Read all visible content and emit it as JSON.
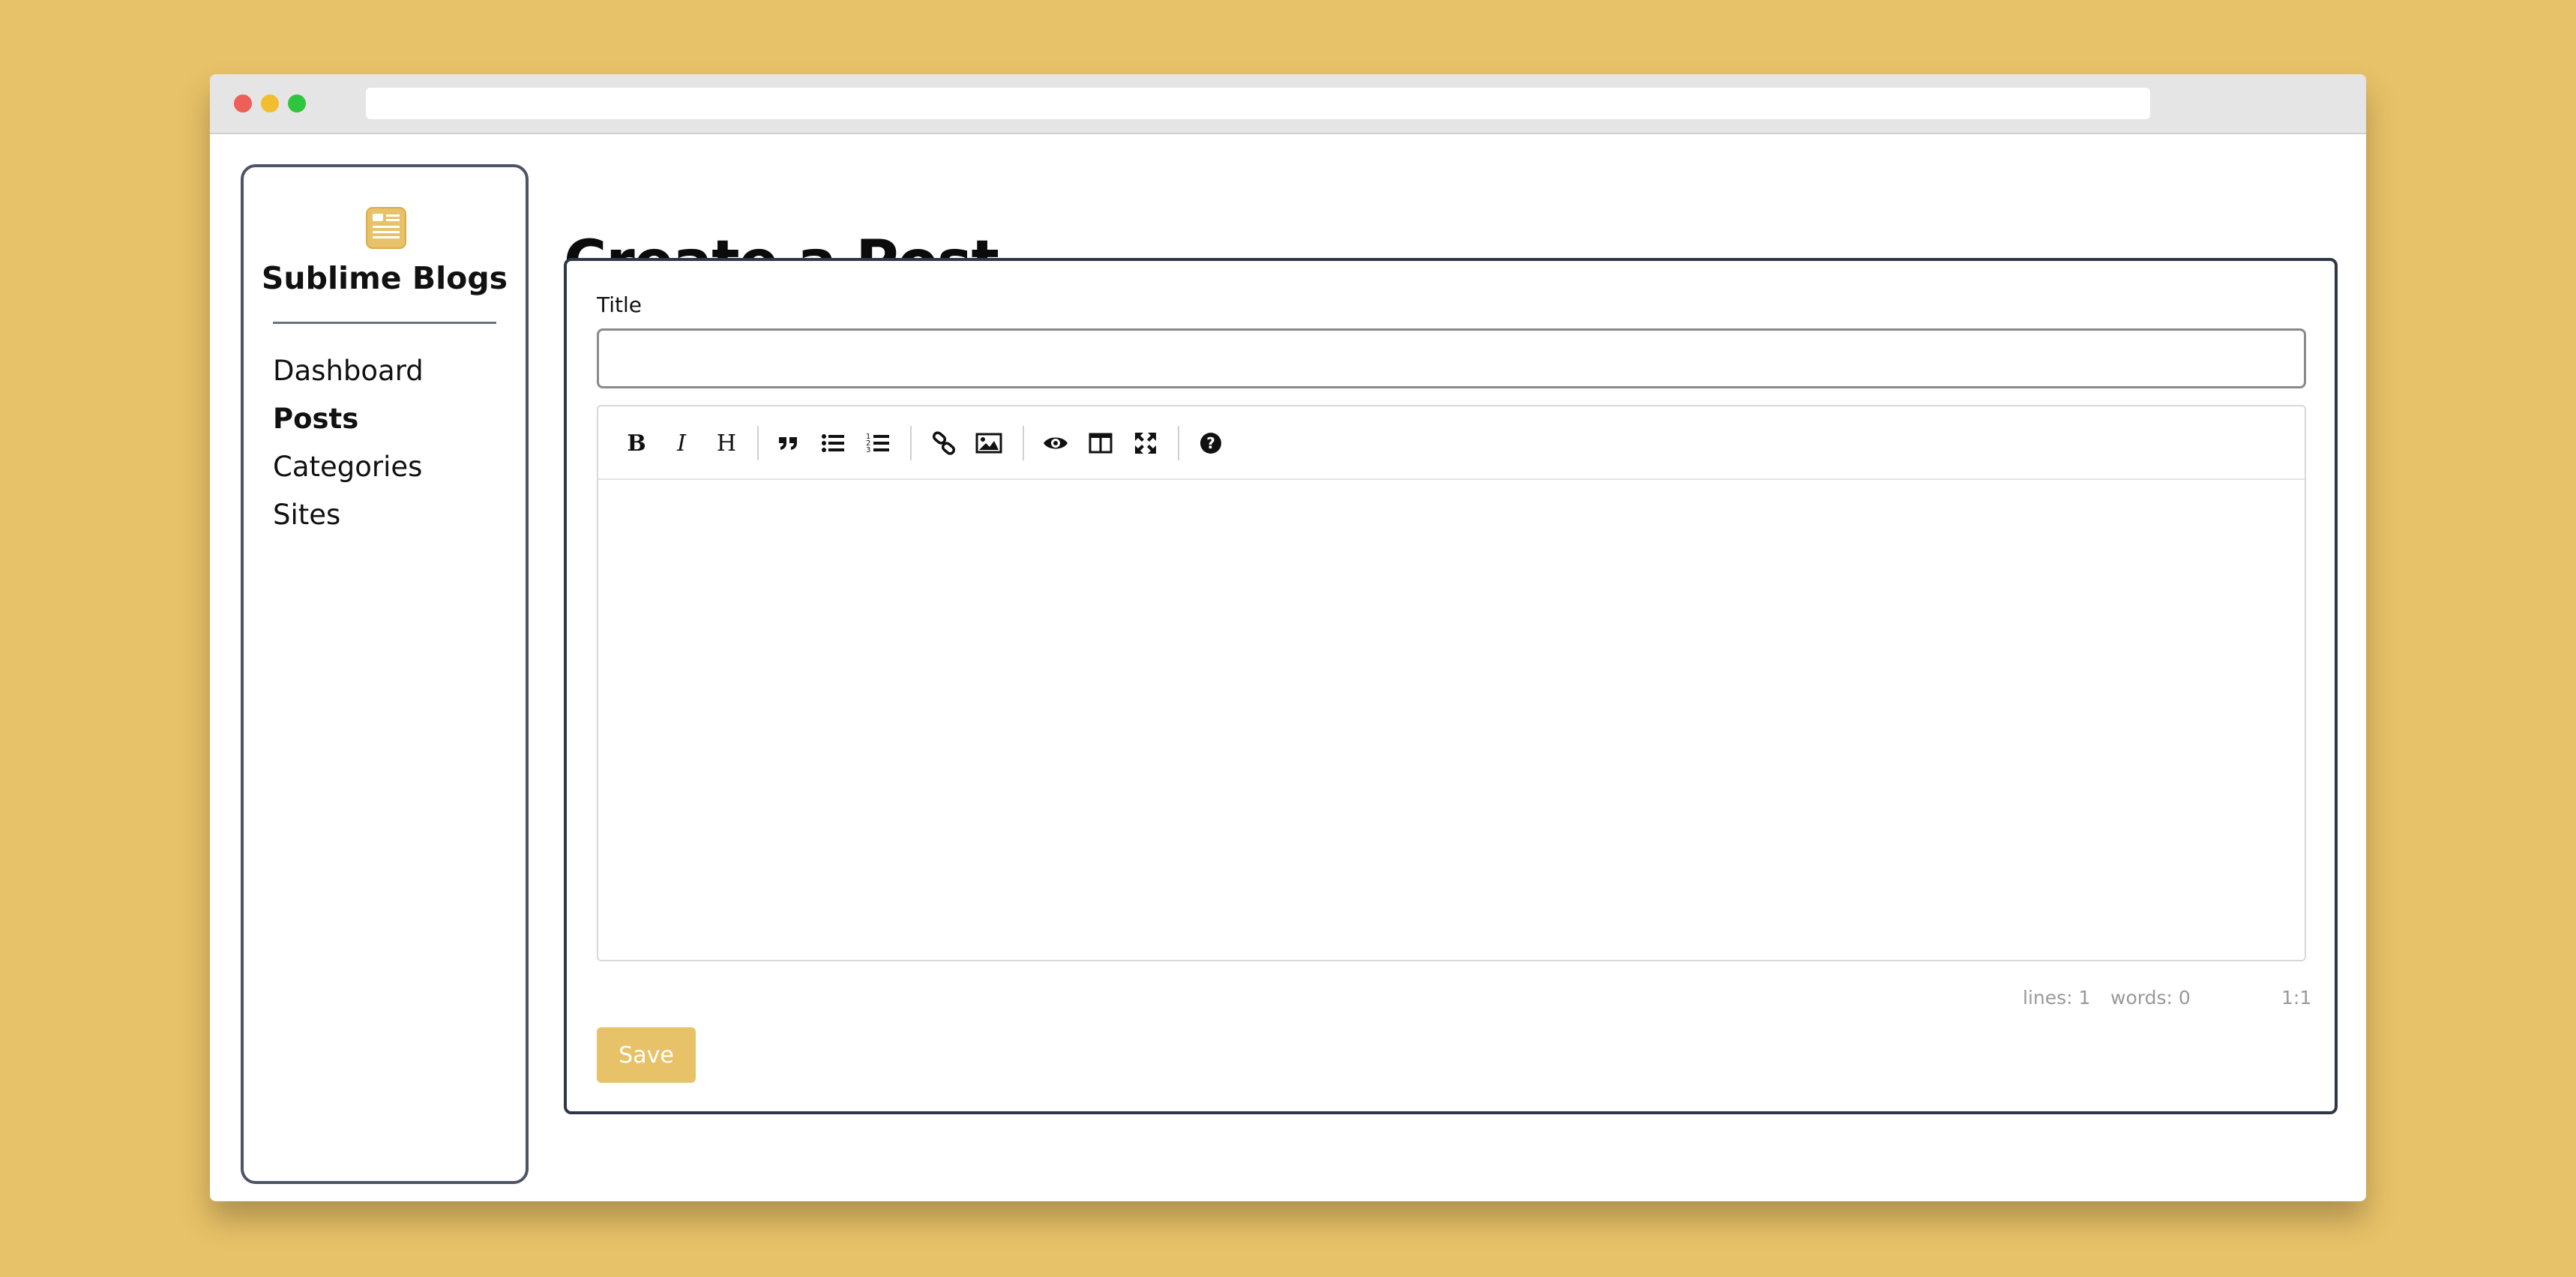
{
  "sidebar": {
    "logo_icon": "newspaper-icon",
    "brand": "Sublime Blogs",
    "items": [
      {
        "label": "Dashboard",
        "active": false
      },
      {
        "label": "Posts",
        "active": true
      },
      {
        "label": "Categories",
        "active": false
      },
      {
        "label": "Sites",
        "active": false
      }
    ]
  },
  "main": {
    "page_title": "Create a Post",
    "form": {
      "title_label": "Title",
      "title_value": "",
      "title_placeholder": "",
      "toolbar": {
        "tools": [
          "bold-icon",
          "italic-icon",
          "heading-icon",
          "quote-icon",
          "unordered-list-icon",
          "ordered-list-icon",
          "link-icon",
          "image-icon",
          "preview-icon",
          "side-by-side-icon",
          "fullscreen-icon",
          "help-icon"
        ]
      },
      "status": {
        "lines": "lines: 1",
        "words": "words: 0",
        "cursor": "1:1"
      },
      "save_label": "Save"
    }
  },
  "colors": {
    "background": "#E8C268",
    "accent": "#E8C268",
    "card_border": "#2d3748"
  }
}
